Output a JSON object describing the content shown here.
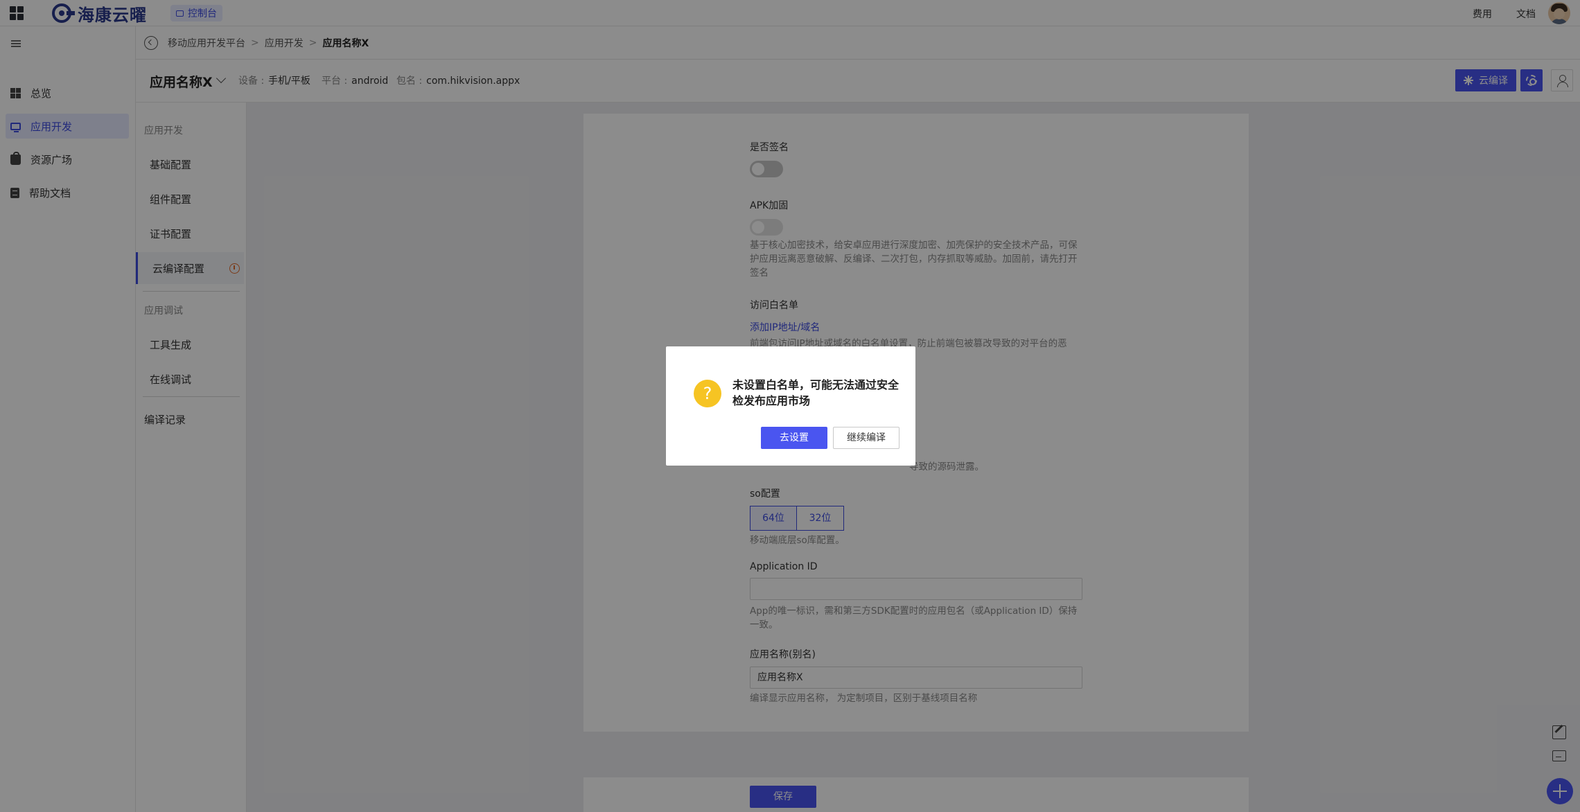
{
  "topbar": {
    "logo_text": "海康云曜",
    "console_label": "控制台",
    "links": [
      "费用",
      "文档"
    ]
  },
  "sidebar": {
    "items": [
      {
        "label": "总览",
        "icon": "grid-icon"
      },
      {
        "label": "应用开发",
        "icon": "monitor-icon",
        "active": true
      },
      {
        "label": "资源广场",
        "icon": "bag-icon"
      },
      {
        "label": "帮助文档",
        "icon": "doc-icon"
      }
    ]
  },
  "breadcrumb": [
    "移动应用开发平台",
    "应用开发",
    "应用名称X"
  ],
  "breadcrumb_sep": ">",
  "app": {
    "name": "应用名称X",
    "device_label": "设备 :",
    "device": "手机/平板",
    "platform_label": "平台 :",
    "platform": "android",
    "package_label": "包名 :",
    "package": "com.hikvision.appx",
    "cloud_build_label": "云编译"
  },
  "subnav": {
    "group1": "应用开发",
    "items1": [
      "基础配置",
      "组件配置",
      "证书配置",
      "云编译配置"
    ],
    "group2": "应用调试",
    "items2": [
      "工具生成",
      "在线调试"
    ],
    "records": "编译记录"
  },
  "form": {
    "sign_label": "是否签名",
    "apk_label": "APK加固",
    "apk_hint": "基于核心加密技术，给安卓应用进行深度加密、加壳保护的安全技术产品，可保护应用远离恶意破解、反编译、二次打包，内存抓取等威胁。加固前，请先打开签名",
    "whitelist_label": "访问白名单",
    "whitelist_link": "添加IP地址/域名",
    "whitelist_hint": "前端包访问IP地址或域名的白名单设置，防止前端包被篡改导致的对平台的恶",
    "source_hint_tail": "导致的源码泄露。",
    "so_label": "so配置",
    "so_options": [
      "64位",
      "32位"
    ],
    "so_hint": "移动端底层so库配置。",
    "appid_label": "Application ID",
    "appid_value": "",
    "appid_hint": "App的唯一标识，需和第三方SDK配置时的应用包名（或Application ID）保持一致。",
    "alias_label": "应用名称(别名)",
    "alias_value": "应用名称X",
    "alias_hint": "编译显示应用名称， 为定制项目，区别于基线项目名称",
    "save_label": "保存"
  },
  "modal": {
    "message": "未设置白名单，可能无法通过安全检发布应用市场",
    "icon": "?",
    "primary_label": "去设置",
    "secondary_label": "继续编译"
  },
  "colors": {
    "accent": "#4a55f0",
    "warning": "#f6c423"
  }
}
